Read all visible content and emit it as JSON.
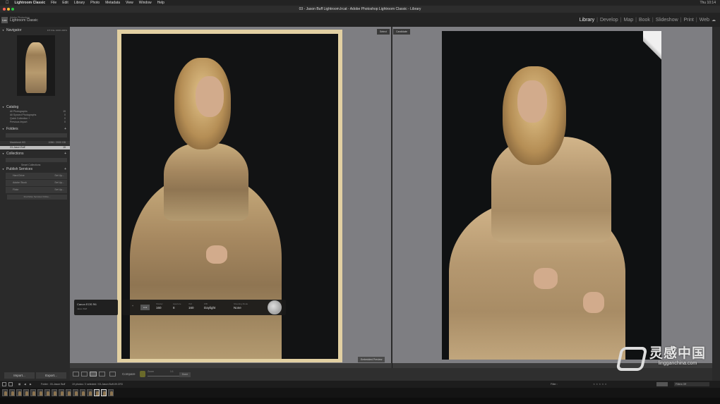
{
  "menubar": {
    "app_name": "Lightroom Classic",
    "items": [
      "File",
      "Edit",
      "Library",
      "Photo",
      "Metadata",
      "View",
      "Window",
      "Help"
    ],
    "right": "Thu 10:14"
  },
  "window": {
    "title": "03 - Jason Buff Lightroom.lrcat - Adobe Photoshop Lightroom Classic - Library"
  },
  "identity": {
    "logo": "Lrc",
    "line1": "Adobe Photoshop",
    "line2": "Lightroom Classic"
  },
  "modules": [
    "Library",
    "Develop",
    "Map",
    "Book",
    "Slideshow",
    "Print",
    "Web"
  ],
  "navigator": {
    "title": "Navigator",
    "zoom": [
      "FIT",
      "FILL",
      "100%",
      "200%"
    ]
  },
  "catalog": {
    "title": "Catalog",
    "items": [
      {
        "label": "All Photographs",
        "count": "19"
      },
      {
        "label": "All Synced Photographs",
        "count": "0"
      },
      {
        "label": "Quick Collection +",
        "count": "0"
      },
      {
        "label": "Previous Import",
        "count": "0"
      }
    ]
  },
  "folders": {
    "title": "Folders",
    "volume": "Macintosh HD",
    "volume_info": "1086 / 2000 GB",
    "folder": "03-Jason Buff",
    "folder_count": "19"
  },
  "collections": {
    "title": "Collections",
    "items": [
      "Smart Collections"
    ]
  },
  "publish": {
    "title": "Publish Services",
    "items": [
      {
        "label": "Hard Drive",
        "action": "Set Up..."
      },
      {
        "label": "Adobe Stock",
        "action": "Set Up..."
      },
      {
        "label": "Flickr",
        "action": "Set Up..."
      }
    ],
    "find_more": "Find More Services Online..."
  },
  "buttons": {
    "import": "Import...",
    "export": "Export..."
  },
  "compare": {
    "select_label": "Select",
    "candidate_label": "Candidate",
    "embedded_preview": "Embedded Preview"
  },
  "info_overlay": {
    "camera": "Canon EOS R6",
    "lens": "Jason Buff",
    "lock": "Link",
    "fields": [
      {
        "key": "Shutter",
        "value": "160"
      },
      {
        "key": "Aperture",
        "value": "8"
      },
      {
        "key": "ISO",
        "value": "160"
      },
      {
        "key": "WB",
        "value": "Daylight"
      },
      {
        "key": "Shooting Mode",
        "value": "None"
      }
    ]
  },
  "toolbar": {
    "compare": "Compare",
    "zoom_label": "Zoom",
    "zoom_value": "1:1",
    "done": "Done"
  },
  "statusbar": {
    "folder": "Folder : 03-Jason Buff",
    "counts": "19 photos / 2 selected / 03-Jason Buff-09.CR3",
    "filter": "Filter :",
    "filters_off": "Filters Off"
  },
  "watermark": {
    "cn": "灵感中国",
    "url": "lingganchina.com"
  }
}
